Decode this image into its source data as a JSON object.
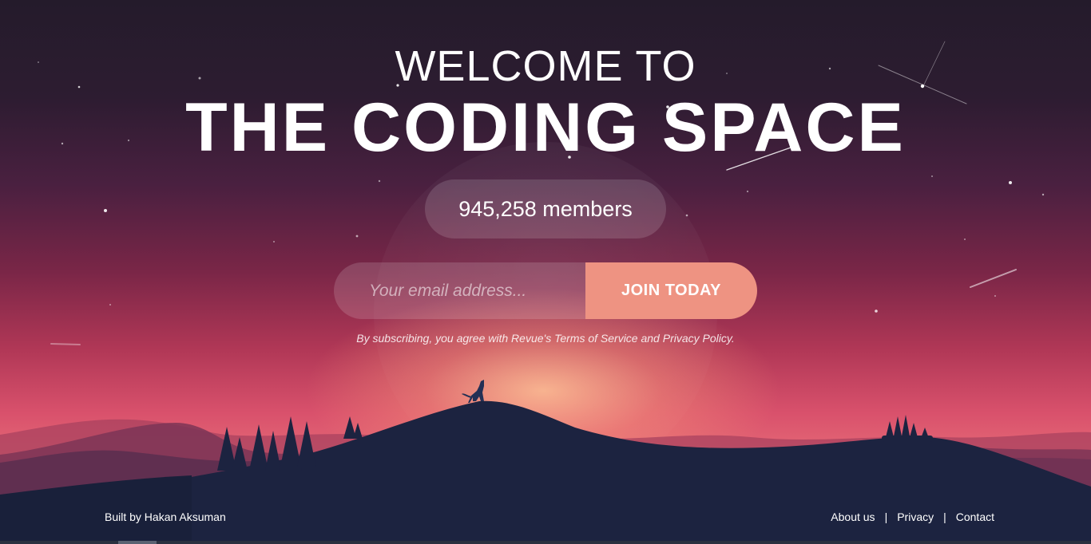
{
  "hero": {
    "welcome": "WELCOME TO",
    "title": "THE CODING SPACE",
    "members": "945,258 members"
  },
  "signup": {
    "email_placeholder": "Your email address...",
    "email_value": "",
    "join_label": "JOIN TODAY",
    "terms": "By subscribing, you agree with Revue's Terms of Service and Privacy Policy."
  },
  "footer": {
    "credit": "Built by Hakan Aksuman",
    "links": [
      "About us",
      "Privacy",
      "Contact"
    ],
    "separator": "|"
  },
  "colors": {
    "button": "#ee9382",
    "sky_top": "#241b2b",
    "sky_mid": "#b03756",
    "mountains": "#1c2340"
  }
}
